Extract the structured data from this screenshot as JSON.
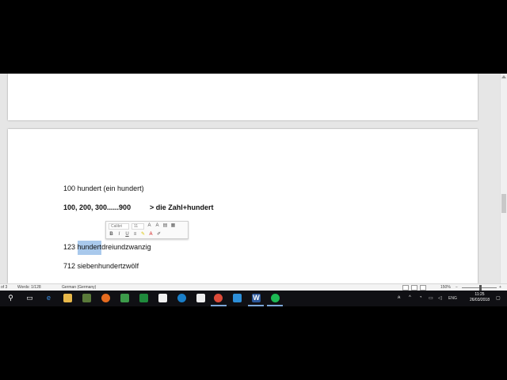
{
  "document": {
    "line1": "100 hundert (ein hundert)",
    "line2_left": "100, 200, 300......900",
    "line2_right": "> die Zahl+hundert",
    "line3_prefix": "123 ",
    "line3_selected": "hundert",
    "line3_suffix": "dreiundzwanzig",
    "line4": "712 siebenhundertzwölf"
  },
  "mini_toolbar": {
    "font_name": "Calibri",
    "font_size": "11",
    "bold": "B",
    "italic": "I",
    "underline": "U",
    "font_color": "A"
  },
  "status_bar": {
    "page_info": "of 3",
    "words": "Words: 1/128",
    "language": "German (Germany)",
    "zoom": "150%"
  },
  "taskbar": {
    "input_lang": "ENG",
    "time": "11:25",
    "date": "26/03/2018"
  },
  "colors": {
    "selection": "#a9c9ec",
    "taskbar": "#101014",
    "word_blue": "#2b579a"
  }
}
